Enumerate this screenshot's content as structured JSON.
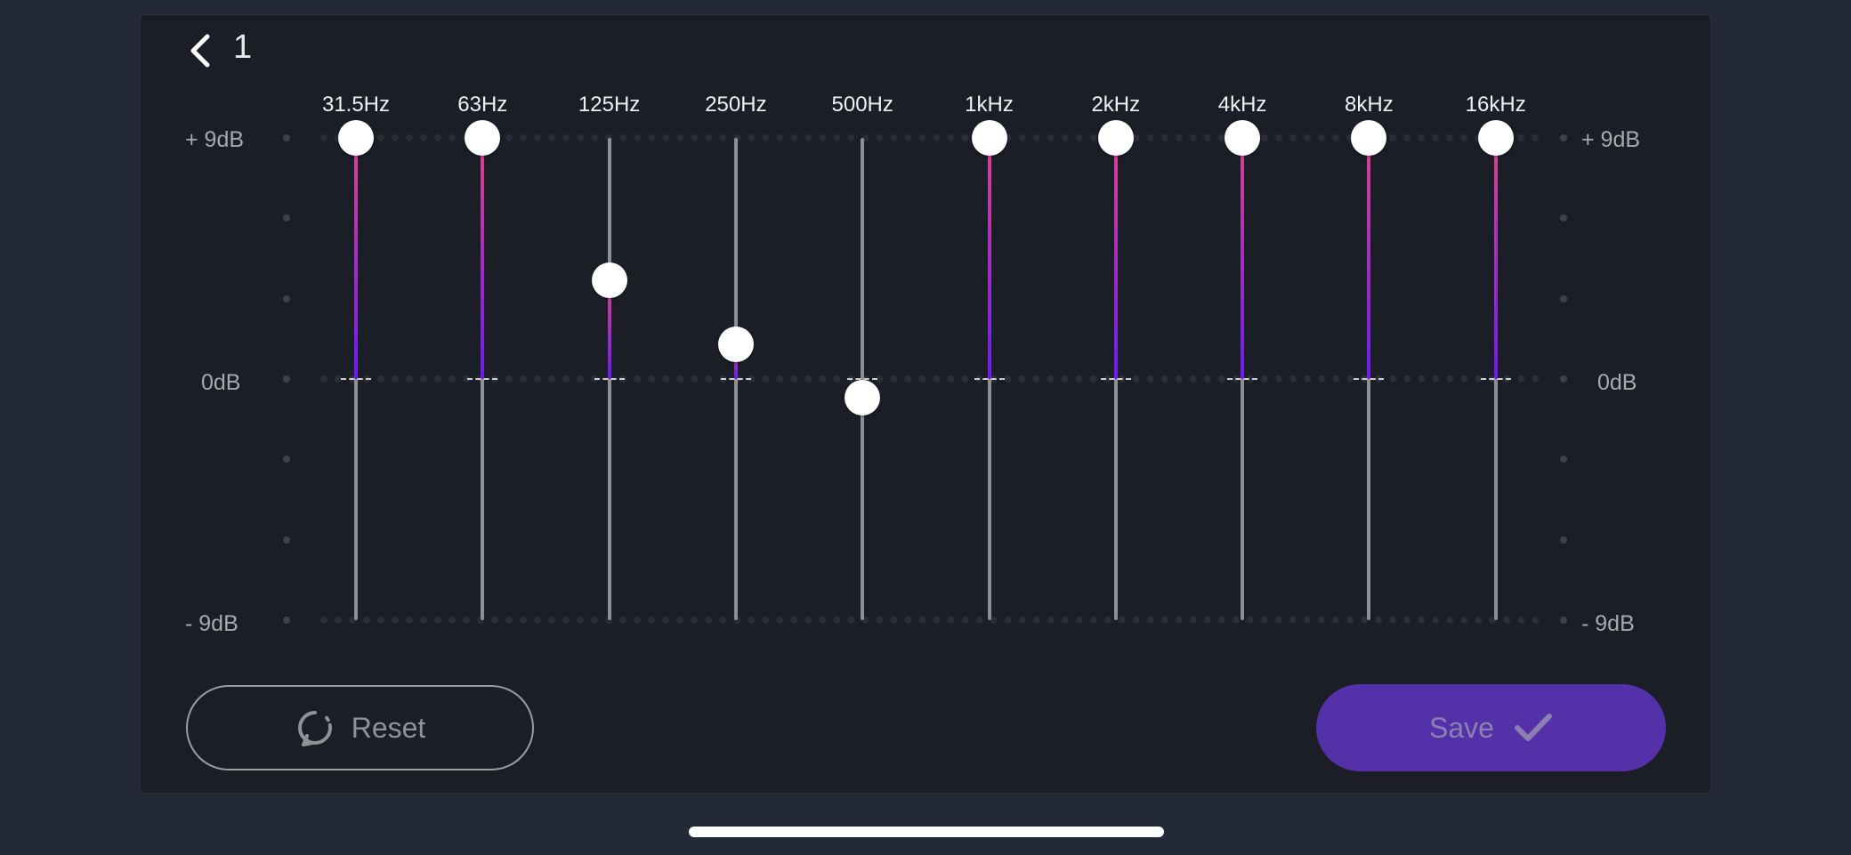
{
  "header": {
    "back_icon": "chevron-left-icon",
    "preset_name": "1"
  },
  "scale": {
    "top": "+ 9dB",
    "middle": "0dB",
    "bottom": "- 9dB",
    "min_db": -9,
    "max_db": 9
  },
  "bands": [
    {
      "freq": "31.5Hz",
      "gain_db": 9
    },
    {
      "freq": "63Hz",
      "gain_db": 9
    },
    {
      "freq": "125Hz",
      "gain_db": 3.7
    },
    {
      "freq": "250Hz",
      "gain_db": 1.3
    },
    {
      "freq": "500Hz",
      "gain_db": -0.7
    },
    {
      "freq": "1kHz",
      "gain_db": 9
    },
    {
      "freq": "2kHz",
      "gain_db": 9
    },
    {
      "freq": "4kHz",
      "gain_db": 9
    },
    {
      "freq": "8kHz",
      "gain_db": 9
    },
    {
      "freq": "16kHz",
      "gain_db": 9
    }
  ],
  "actions": {
    "reset_label": "Reset",
    "reset_icon": "reset-icon",
    "save_label": "Save",
    "save_icon": "checkmark-icon"
  },
  "colors": {
    "accent": "#5431a8",
    "fill_top": "#e0418e",
    "fill_bottom": "#6a1cf0"
  }
}
